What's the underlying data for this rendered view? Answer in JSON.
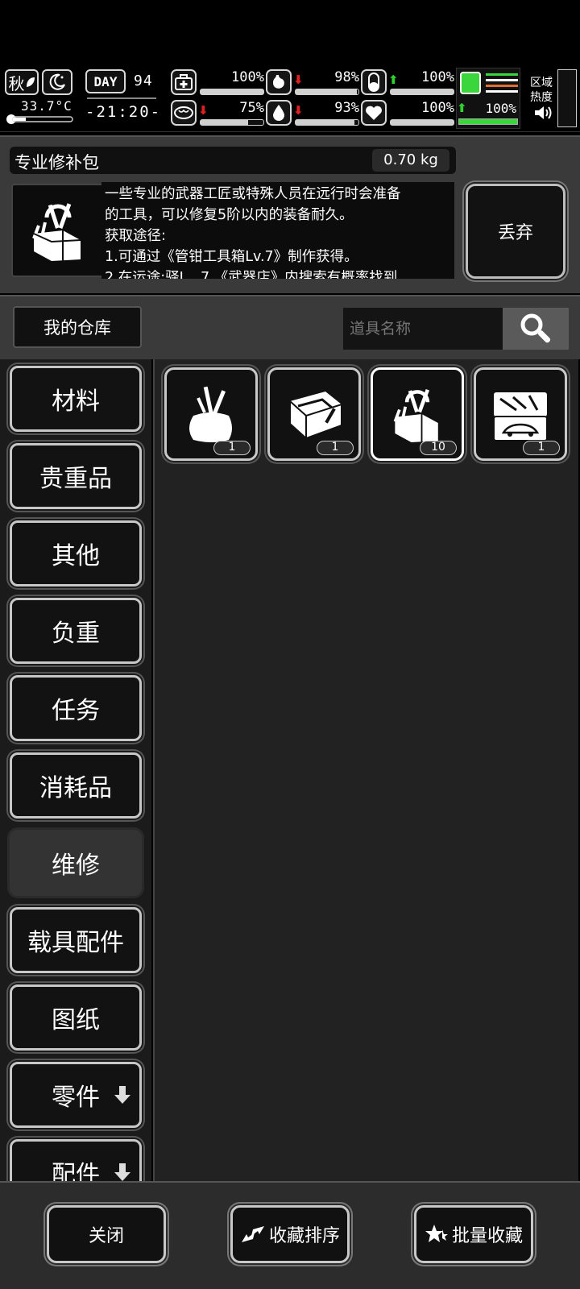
{
  "hud": {
    "season": "秋",
    "temperature": "33.7°C",
    "day_label": "DAY",
    "day_number": "94",
    "clock": "-21:20-",
    "region_label_1": "区域",
    "region_label_2": "热度",
    "stats": [
      {
        "id": "health",
        "value": "100%",
        "trend": "",
        "fill": 1.0
      },
      {
        "id": "stomach",
        "value": "98%",
        "trend": "down",
        "fill": 0.98
      },
      {
        "id": "pill",
        "value": "100%",
        "trend": "up",
        "fill": 1.0
      },
      {
        "id": "brain",
        "value": "75%",
        "trend": "down",
        "fill": 0.75
      },
      {
        "id": "water",
        "value": "93%",
        "trend": "down",
        "fill": 0.93
      },
      {
        "id": "heart",
        "value": "100%",
        "trend": "",
        "fill": 1.0
      },
      {
        "id": "stamina",
        "value": "100%",
        "trend": "up",
        "fill": 1.0
      }
    ]
  },
  "detail": {
    "name": "专业修补包",
    "weight": "0.70 kg",
    "description_lines": [
      "一些专业的武器工匠或特殊人员在远行时会准备",
      "的工具，可以修复5阶以内的装备耐久。",
      "获取途径:",
      "1.可通过《管钳工具箱Lv.7》制作获得。",
      "2.在运途:驿L...7 《武器店》内搜索有概率找到"
    ],
    "discard_label": "丢弃"
  },
  "search": {
    "warehouse_label": "我的仓库",
    "placeholder": "道具名称"
  },
  "categories": [
    {
      "label": "材料"
    },
    {
      "label": "贵重品"
    },
    {
      "label": "其他"
    },
    {
      "label": "负重"
    },
    {
      "label": "任务"
    },
    {
      "label": "消耗品"
    },
    {
      "label": "维修",
      "active": true
    },
    {
      "label": "载具配件"
    },
    {
      "label": "图纸"
    },
    {
      "label": "零件",
      "has_arrow": true
    },
    {
      "label": "配件",
      "has_arrow": true
    }
  ],
  "items": [
    {
      "icon": "repair-bag-icon",
      "count": "1"
    },
    {
      "icon": "toolbox-pliers-icon",
      "count": "1"
    },
    {
      "icon": "professional-repair-kit-icon",
      "count": "10",
      "selected": true
    },
    {
      "icon": "vehicle-toolbox-icon",
      "count": "1"
    }
  ],
  "bottom": {
    "close_label": "关闭",
    "sort_label": "收藏排序",
    "batch_label": "批量收藏"
  }
}
